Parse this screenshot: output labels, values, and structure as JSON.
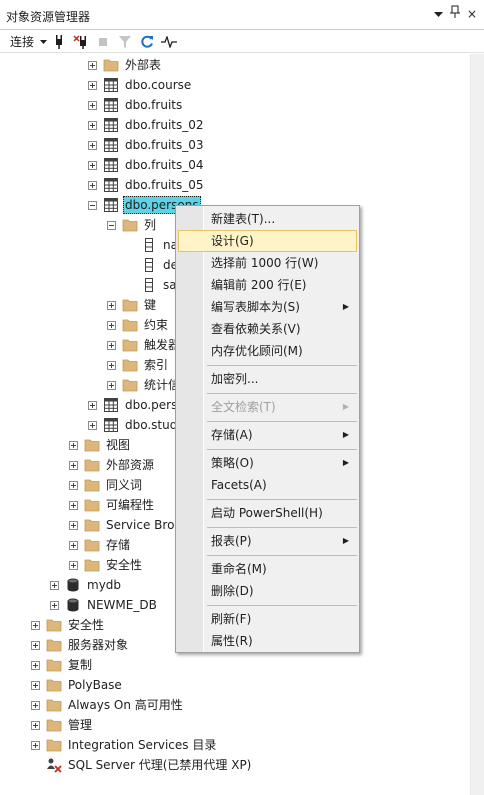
{
  "window": {
    "title": "对象资源管理器",
    "pin": "ᵽ",
    "close": "×"
  },
  "toolbar": {
    "connect_label": "连接"
  },
  "tree": {
    "external_tables": "外部表",
    "course": "dbo.course",
    "fruits": "dbo.fruits",
    "fruits_02": "dbo.fruits_02",
    "fruits_03": "dbo.fruits_03",
    "fruits_04": "dbo.fruits_04",
    "fruits_05": "dbo.fruits_05",
    "persons_selected": "dbo.persons",
    "columns": "列",
    "col_1": "na",
    "col_2": "de",
    "col_3": "sa",
    "keys": "键",
    "constraints": "约束",
    "triggers": "触发器",
    "indexes": "索引",
    "statistics": "统计信",
    "persons_2": "dbo.pers",
    "students": "dbo.stud",
    "views": "视图",
    "external_resources": "外部资源",
    "synonyms": "同义词",
    "programmability": "可编程性",
    "service_broker": "Service Brok",
    "storage": "存储",
    "security_db": "安全性",
    "mydb": "mydb",
    "newme_db": "NEWME_DB",
    "security": "安全性",
    "server_objects": "服务器对象",
    "replication": "复制",
    "polybase": "PolyBase",
    "always_on": "Always On 高可用性",
    "management": "管理",
    "integration_services": "Integration Services 目录",
    "sql_agent": "SQL Server 代理(已禁用代理 XP)"
  },
  "context_menu": {
    "new_table": "新建表(T)...",
    "design": "设计(G)",
    "select_top": "选择前 1000 行(W)",
    "edit_top": "编辑前 200 行(E)",
    "script_as": "编写表脚本为(S)",
    "view_deps": "查看依赖关系(V)",
    "memory_advisor": "内存优化顾问(M)",
    "encrypt_columns": "加密列...",
    "fulltext_index": "全文检索(T)",
    "storage": "存储(A)",
    "policies": "策略(O)",
    "facets": "Facets(A)",
    "start_powershell": "启动 PowerShell(H)",
    "reports": "报表(P)",
    "rename": "重命名(M)",
    "delete": "删除(D)",
    "refresh": "刷新(F)",
    "properties": "属性(R)"
  },
  "colors": {
    "selection": "#5ed2e6",
    "menu_highlight": "#fff4c8",
    "folder": "#dcb67a",
    "refresh_icon": "#1e6fbf"
  }
}
